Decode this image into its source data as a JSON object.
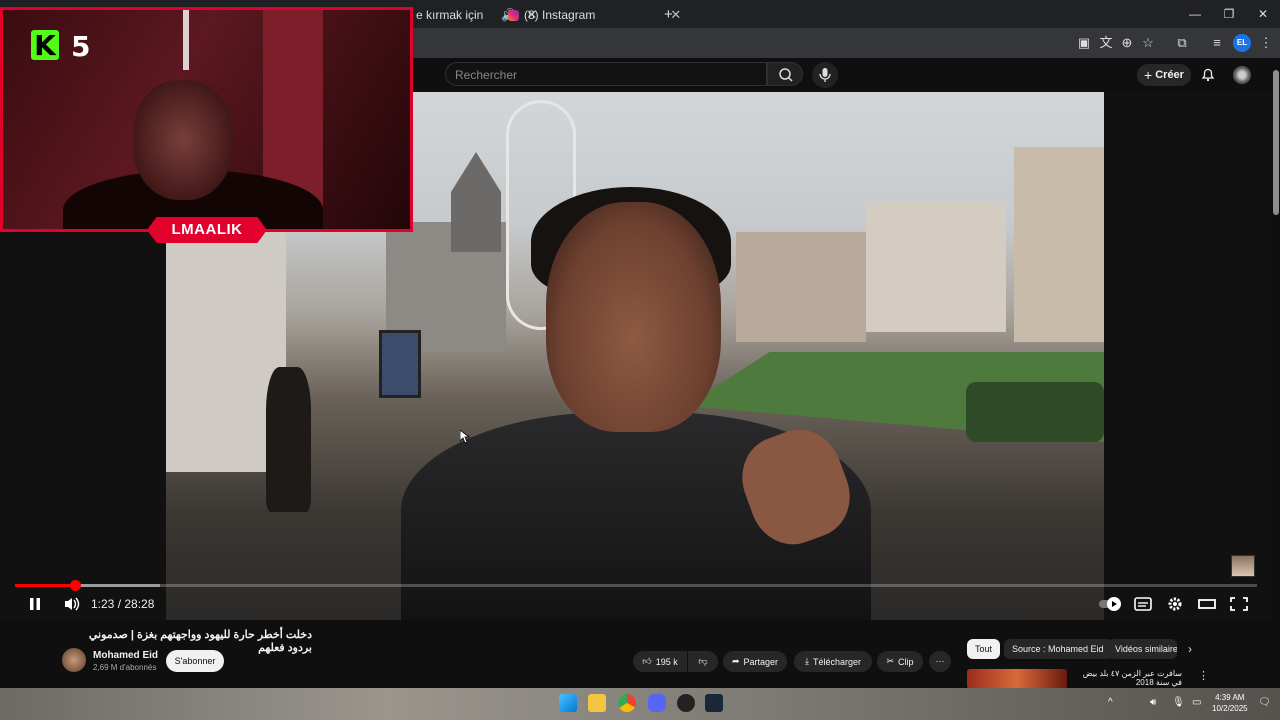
{
  "browser": {
    "tabs": [
      {
        "title": "e kırmak için"
      },
      {
        "title": "(8) Instagram"
      }
    ],
    "new_tab": "+",
    "window_controls": {
      "minimize": "—",
      "restore": "❐",
      "close": "✕"
    },
    "profile_initials": "EL"
  },
  "youtube_header": {
    "search_placeholder": "Rechercher",
    "create_label": "Créer"
  },
  "overlay": {
    "logo_letter": "K",
    "logo_number": "5",
    "streamer_name": "LMAALIK"
  },
  "player": {
    "time_current": "1:23",
    "time_total": "28:28",
    "time_display": "1:23 / 28:28",
    "progress_fraction": 0.0486
  },
  "video_info": {
    "title": "دخلت أخطر حارة لليهود وواجهتهم بغزة | صدموني بردود فعلهم",
    "channel_name": "Mohamed Eid",
    "subscribers": "2,69 M d'abonnés",
    "subscribe_label": "S'abonner",
    "likes": "195 k",
    "share_label": "Partager",
    "download_label": "Télécharger",
    "clip_label": "Clip"
  },
  "recommendations": {
    "chips": [
      "Tout",
      "Source : Mohamed Eid",
      "Vidéos similaire"
    ],
    "first_title": "سافرت عبر الزمن ٤٧ بلد بيض في سنة 2018"
  },
  "taskbar": {
    "time": "4:39 AM",
    "date": "10/2/2025"
  }
}
